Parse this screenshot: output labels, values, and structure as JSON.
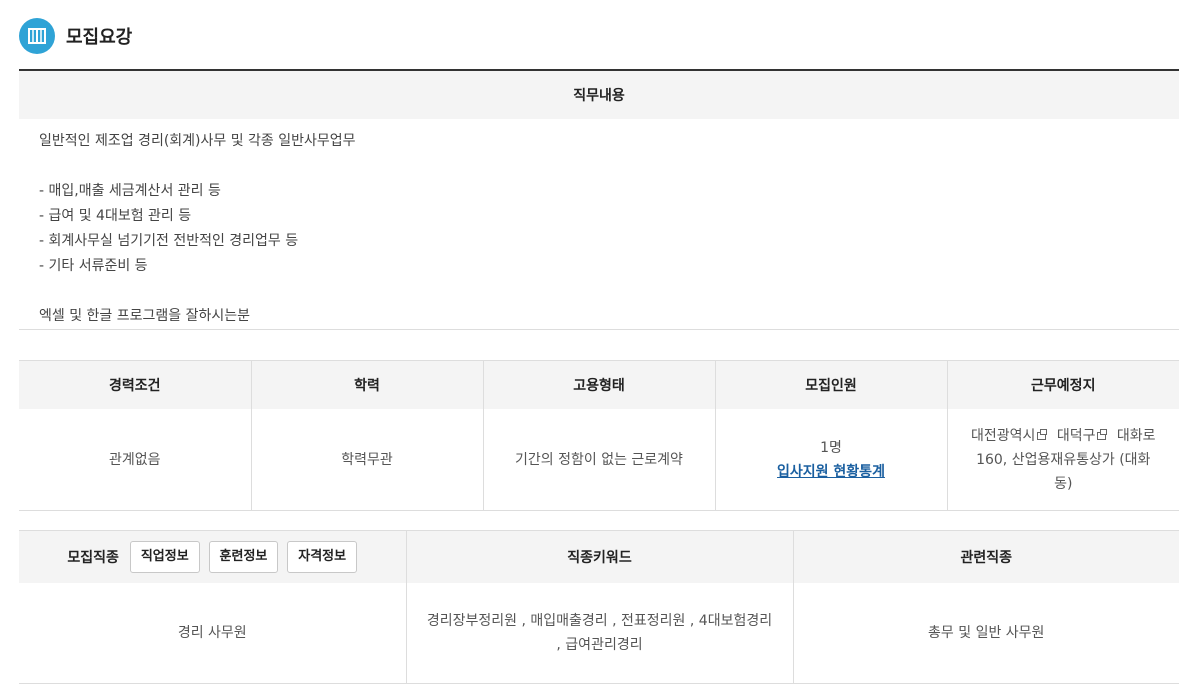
{
  "header": {
    "title": "모집요강",
    "icon": "book-icon",
    "accent": "#2fa3d6"
  },
  "job_content": {
    "heading": "직무내용",
    "lines": [
      "일반적인 제조업 경리(회계)사무 및 각종 일반사무업무",
      "",
      "- 매입,매출 세금계산서 관리 등",
      "- 급여 및 4대보험 관리 등",
      "- 회계사무실 넘기기전 전반적인 경리업무 등",
      "- 기타 서류준비 등",
      "",
      "엑셀 및 한글 프로그램을 잘하시는분"
    ]
  },
  "conditions": {
    "headers": [
      "경력조건",
      "학력",
      "고용형태",
      "모집인원",
      "근무예정지"
    ],
    "experience": "관계없음",
    "education": "학력무관",
    "employment_type": "기간의 정함이 없는 근로계약",
    "recruit_count": "1명",
    "recruit_stats_link": "입사지원 현황통계",
    "location_city": "대전광역시",
    "location_district": "대덕구",
    "location_rest": "대화로 160, 산업용재유통상가 (대화동)"
  },
  "job_type": {
    "label": "모집직종",
    "buttons": [
      "직업정보",
      "훈련정보",
      "자격정보"
    ],
    "headers": [
      "직종키워드",
      "관련직종"
    ],
    "job_name": "경리 사무원",
    "keywords": "경리장부정리원 , 매입매출경리 , 전표정리원 , 4대보험경리 , 급여관리경리",
    "related": "총무 및 일반 사무원"
  }
}
